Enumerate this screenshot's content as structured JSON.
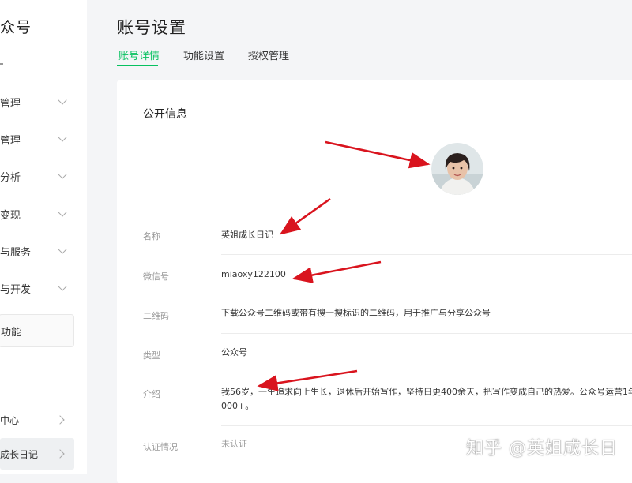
{
  "sidebar": {
    "brand": "众号",
    "items": [
      {
        "label": "管理"
      },
      {
        "label": "管理"
      },
      {
        "label": "分析"
      },
      {
        "label": "变现"
      },
      {
        "label": "与服务"
      },
      {
        "label": "与开发"
      }
    ],
    "box_item": "功能",
    "bottom_items": [
      {
        "label": "中心"
      },
      {
        "label": "成长日记"
      }
    ]
  },
  "header": {
    "title": "账号设置",
    "tabs": [
      {
        "label": "账号详情",
        "active": true
      },
      {
        "label": "功能设置",
        "active": false
      },
      {
        "label": "授权管理",
        "active": false
      }
    ]
  },
  "profile": {
    "section_title": "公开信息",
    "avatar_icon": "avatar-photo",
    "rows": [
      {
        "label": "名称",
        "value": "英姐成长日记"
      },
      {
        "label": "微信号",
        "value": "miaoxy122100"
      },
      {
        "label": "二维码",
        "value": "下载公众号二维码或带有搜一搜标识的二维码，用于推广与分享公众号"
      },
      {
        "label": "类型",
        "value": "公众号"
      },
      {
        "label": "介绍",
        "value_line1": "我56岁，一生追求向上生长，退休后开始写作，坚持日更400余天，把写作变成自己的热爱。公众号运营1年",
        "value_line2": "000+。"
      },
      {
        "label": "认证情况",
        "value": "未认证"
      }
    ]
  },
  "watermark": "知乎 @英姐成长日",
  "colors": {
    "accent": "#07c160",
    "annotation_arrow": "#d9141e"
  }
}
